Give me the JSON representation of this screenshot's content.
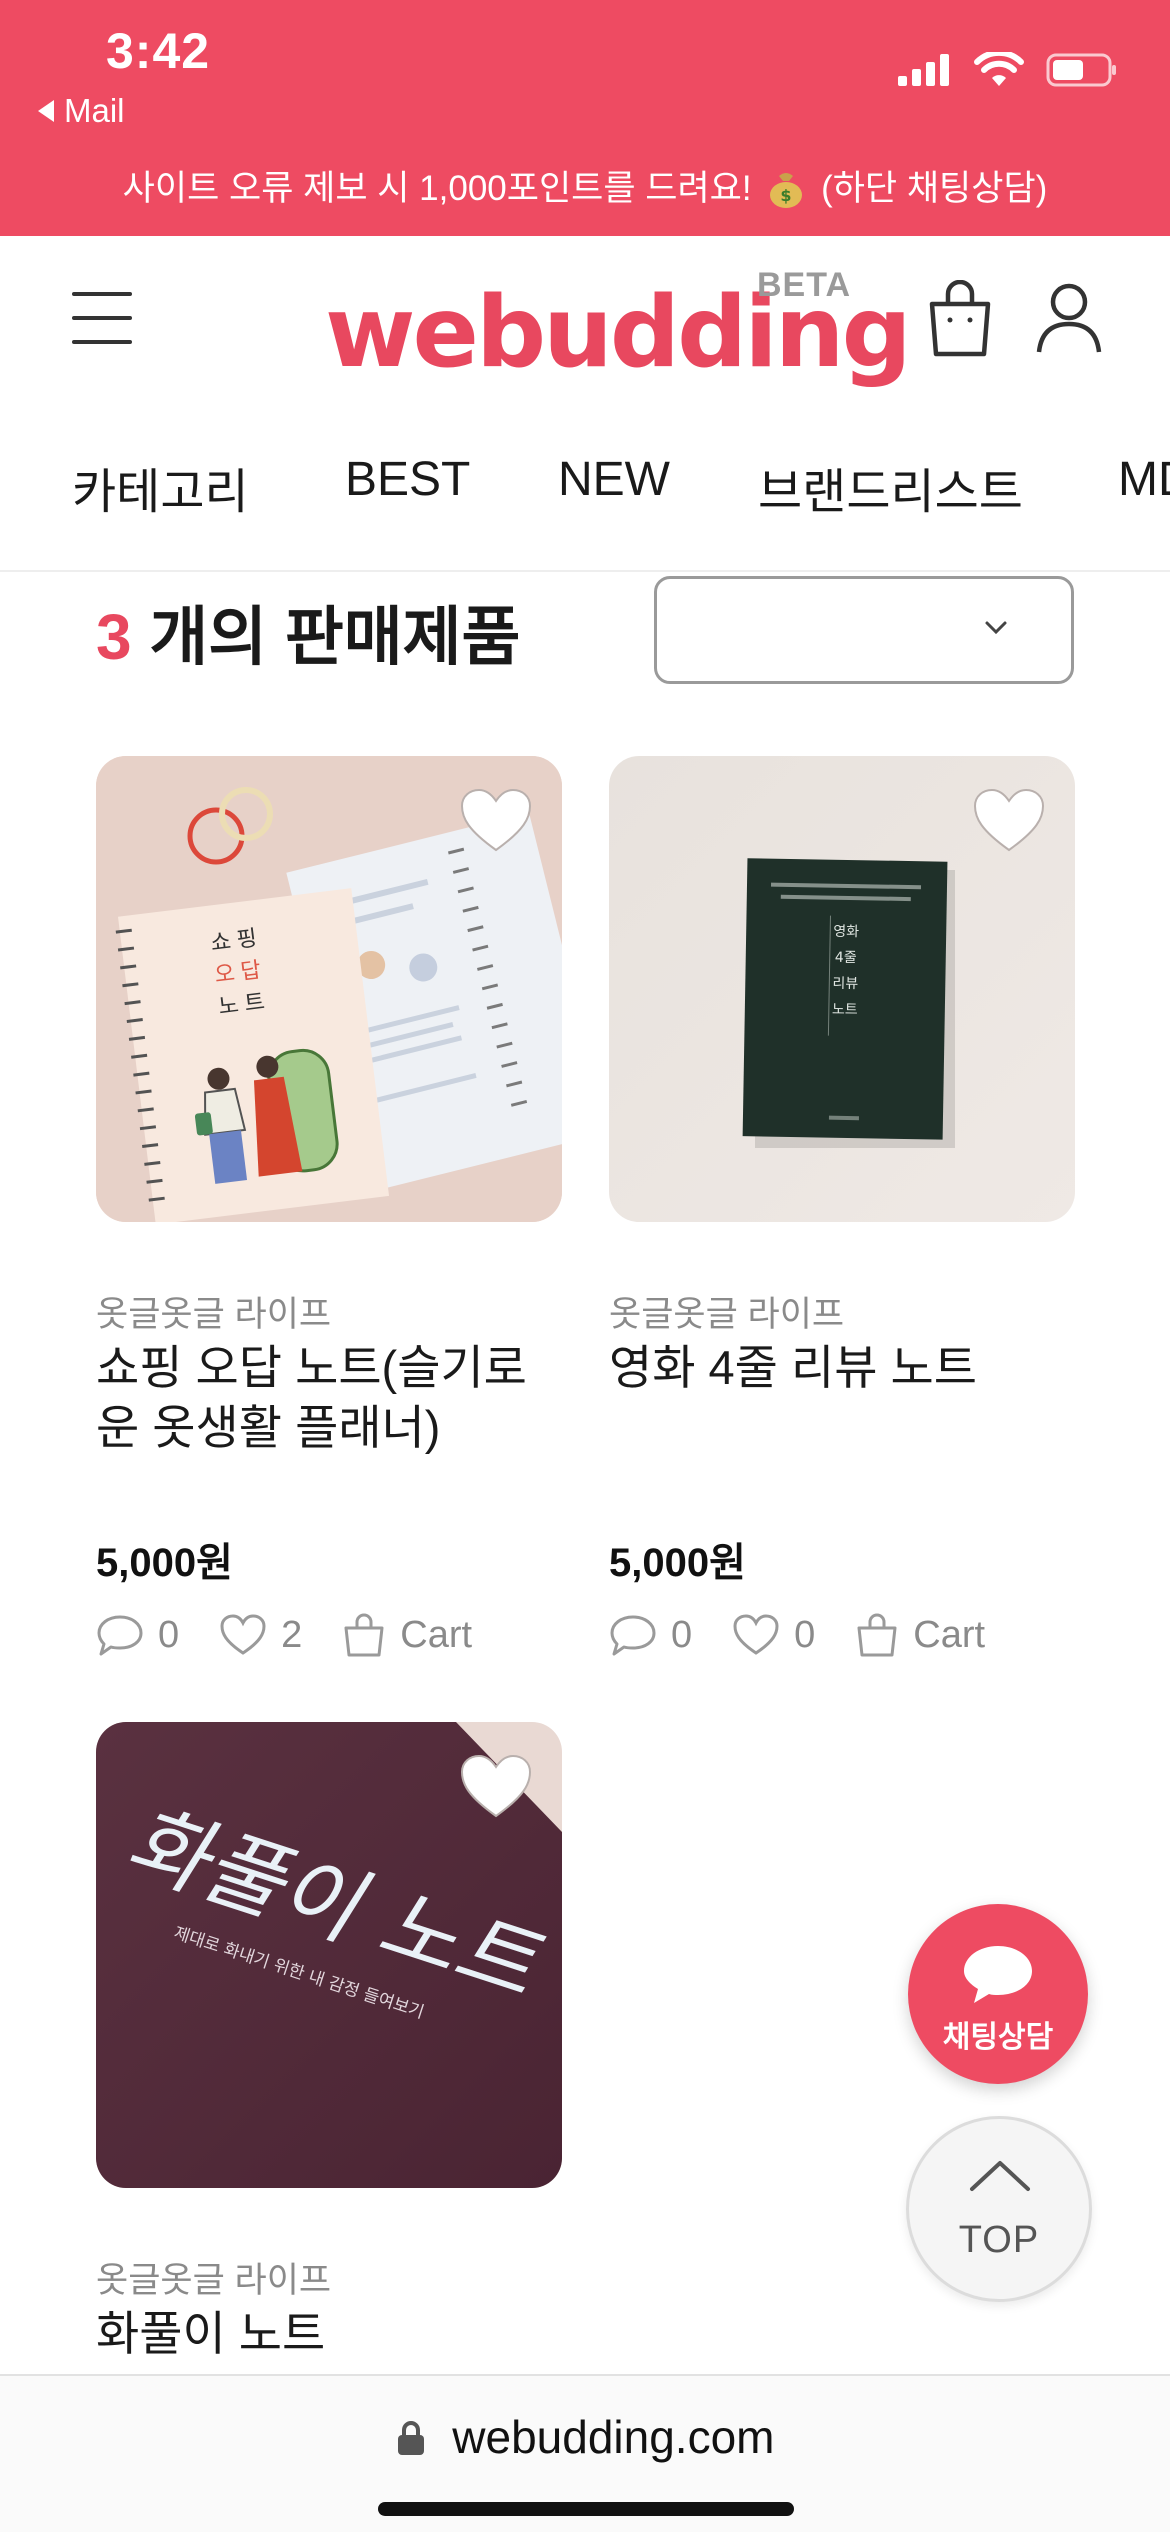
{
  "status_bar": {
    "time": "3:42",
    "back_label": "Mail"
  },
  "banner": {
    "text_before": "사이트 오류 제보 시 1,000포인트를 드려요!",
    "text_after": "(하단 채팅상담)",
    "emoji_icon": "money-bag-icon"
  },
  "header": {
    "logo": "webudding",
    "logo_badge": "BETA"
  },
  "tabs": [
    "카테고리",
    "BEST",
    "NEW",
    "브랜드리스트",
    "MD"
  ],
  "listing": {
    "count": "3",
    "count_suffix": "개의 판매제품",
    "sort_value": ""
  },
  "products": [
    {
      "brand": "옷글옷글 라이프",
      "name": "쇼핑 오답 노트(슬기로운 옷생활 플래너)",
      "price": "5,000원",
      "comments": "0",
      "likes": "2",
      "cart_label": "Cart"
    },
    {
      "brand": "옷글옷글 라이프",
      "name": "영화 4줄 리뷰 노트",
      "price": "5,000원",
      "comments": "0",
      "likes": "0",
      "cart_label": "Cart"
    },
    {
      "brand": "옷글옷글 라이프",
      "name": "화풀이 노트"
    }
  ],
  "product_covers": {
    "p1": {
      "title_lines": [
        "쇼",
        "핑",
        "오",
        "답",
        "노",
        "트"
      ]
    },
    "p2": {
      "title_lines": [
        "영",
        "화",
        "4",
        "줄",
        "리",
        "뷰",
        "노",
        "트"
      ]
    },
    "p3": {
      "title": "화풀이 노트",
      "subtitle": "제대로 화내기 위한 내 감정 들여보기"
    }
  },
  "fab": {
    "chat_label": "채팅상담",
    "top_label": "TOP"
  },
  "urlbar": {
    "url": "webudding.com"
  },
  "colors": {
    "accent": "#ee4b62",
    "brand": "#e8485f"
  }
}
